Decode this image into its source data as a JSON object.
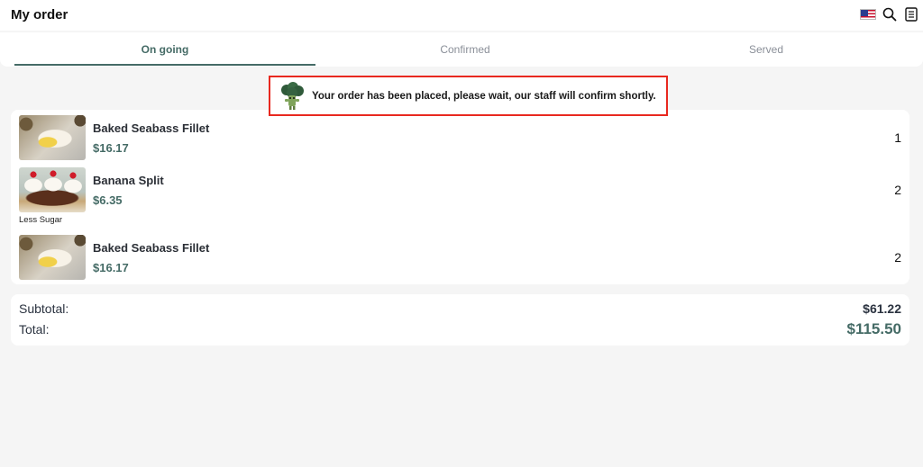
{
  "header": {
    "title": "My order",
    "icons": [
      "us-flag-icon",
      "search-icon",
      "menu-list-icon"
    ]
  },
  "tabs": [
    {
      "label": "On going",
      "active": true
    },
    {
      "label": "Confirmed",
      "active": false
    },
    {
      "label": "Served",
      "active": false
    }
  ],
  "notice": {
    "text": "Your order has been placed, please wait, our staff will confirm shortly.",
    "icon": "broccoli-mascot-icon",
    "border_color": "#e8281f"
  },
  "items": [
    {
      "name": "Baked Seabass Fillet",
      "price": "$16.17",
      "qty": "1",
      "note": "",
      "image": "seabass"
    },
    {
      "name": "Banana Split",
      "price": "$6.35",
      "qty": "2",
      "note": "Less Sugar",
      "image": "banana-split"
    },
    {
      "name": "Baked Seabass Fillet",
      "price": "$16.17",
      "qty": "2",
      "note": "",
      "image": "seabass"
    }
  ],
  "totals": {
    "subtotal_label": "Subtotal:",
    "subtotal_value": "$61.22",
    "total_label": "Total:",
    "total_value": "$115.50"
  },
  "colors": {
    "accent": "#456b66",
    "background": "#f5f5f5"
  }
}
